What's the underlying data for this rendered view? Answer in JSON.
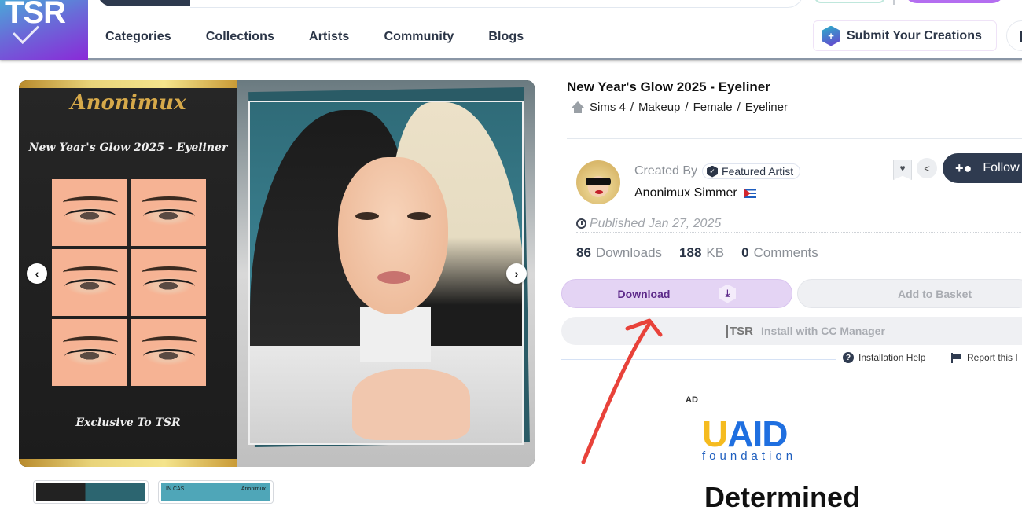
{
  "header": {
    "logo_text": "TSR",
    "nav": [
      "Categories",
      "Collections",
      "Artists",
      "Community",
      "Blogs"
    ],
    "submit_label": "Submit Your Creations",
    "submit_icon": "plus-square-hex-icon"
  },
  "gallery": {
    "brand": "Anonimux",
    "subtitle": "New Year's Glow 2025 - Eyeliner",
    "footer": "Exclusive To TSR",
    "prev_icon": "‹",
    "next_icon": "›",
    "thumb2_label_left": "IN CAS",
    "thumb2_label_right": "Anonimux"
  },
  "item": {
    "title": "New Year's Glow 2025 - Eyeliner",
    "breadcrumb": [
      "Sims 4",
      "Makeup",
      "Female",
      "Eyeliner"
    ],
    "separator": "/",
    "created_by_label": "Created By",
    "badge": "Featured Artist",
    "artist": "Anonimux Simmer",
    "follow_label": "Follow",
    "published": "Published Jan 27, 2025",
    "stats": {
      "downloads_value": "86",
      "downloads_label": "Downloads",
      "size_value": "188",
      "size_label": "KB",
      "comments_value": "0",
      "comments_label": "Comments"
    },
    "download_label": "Download",
    "basket_label": "Add to Basket",
    "cc_logo": "TSR",
    "cc_label": "Install with CC Manager",
    "help_label": "Installation Help",
    "report_label": "Report this I"
  },
  "ad": {
    "label": "AD",
    "logo_u": "U",
    "logo_rest": "AID",
    "logo_sub": "foundation",
    "headline": "Determined"
  },
  "colors": {
    "accent_purple": "#b46ef0",
    "download_bg": "#e4d4f4",
    "follow_bg": "#2f3b50",
    "annotation_red": "#e8423a"
  }
}
